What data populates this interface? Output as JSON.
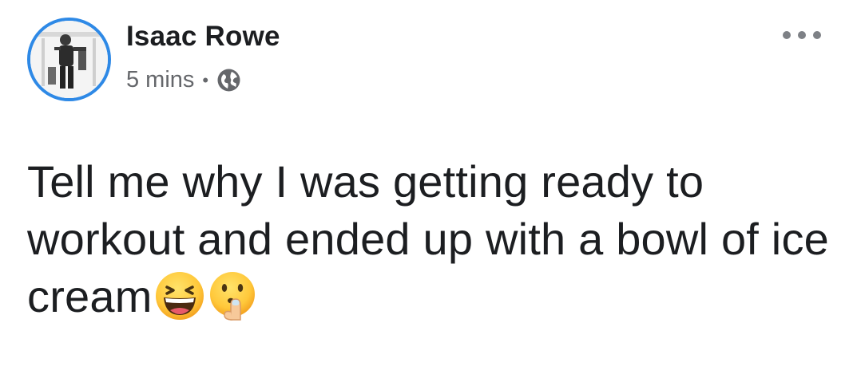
{
  "post": {
    "author": "Isaac Rowe",
    "time": "5 mins",
    "separator": "•",
    "privacy_icon": "globe-icon",
    "menu_icon": "more-options-icon",
    "text": "Tell me why I was getting ready to workout and ended up with a bowl of ice cream",
    "emojis": [
      "grinning-squinting-face-emoji",
      "shushing-face-emoji"
    ]
  },
  "colors": {
    "avatar_ring": "#2e89e6",
    "name": "#1c1e21",
    "meta": "#65676b",
    "body_text": "#1c1e21"
  }
}
